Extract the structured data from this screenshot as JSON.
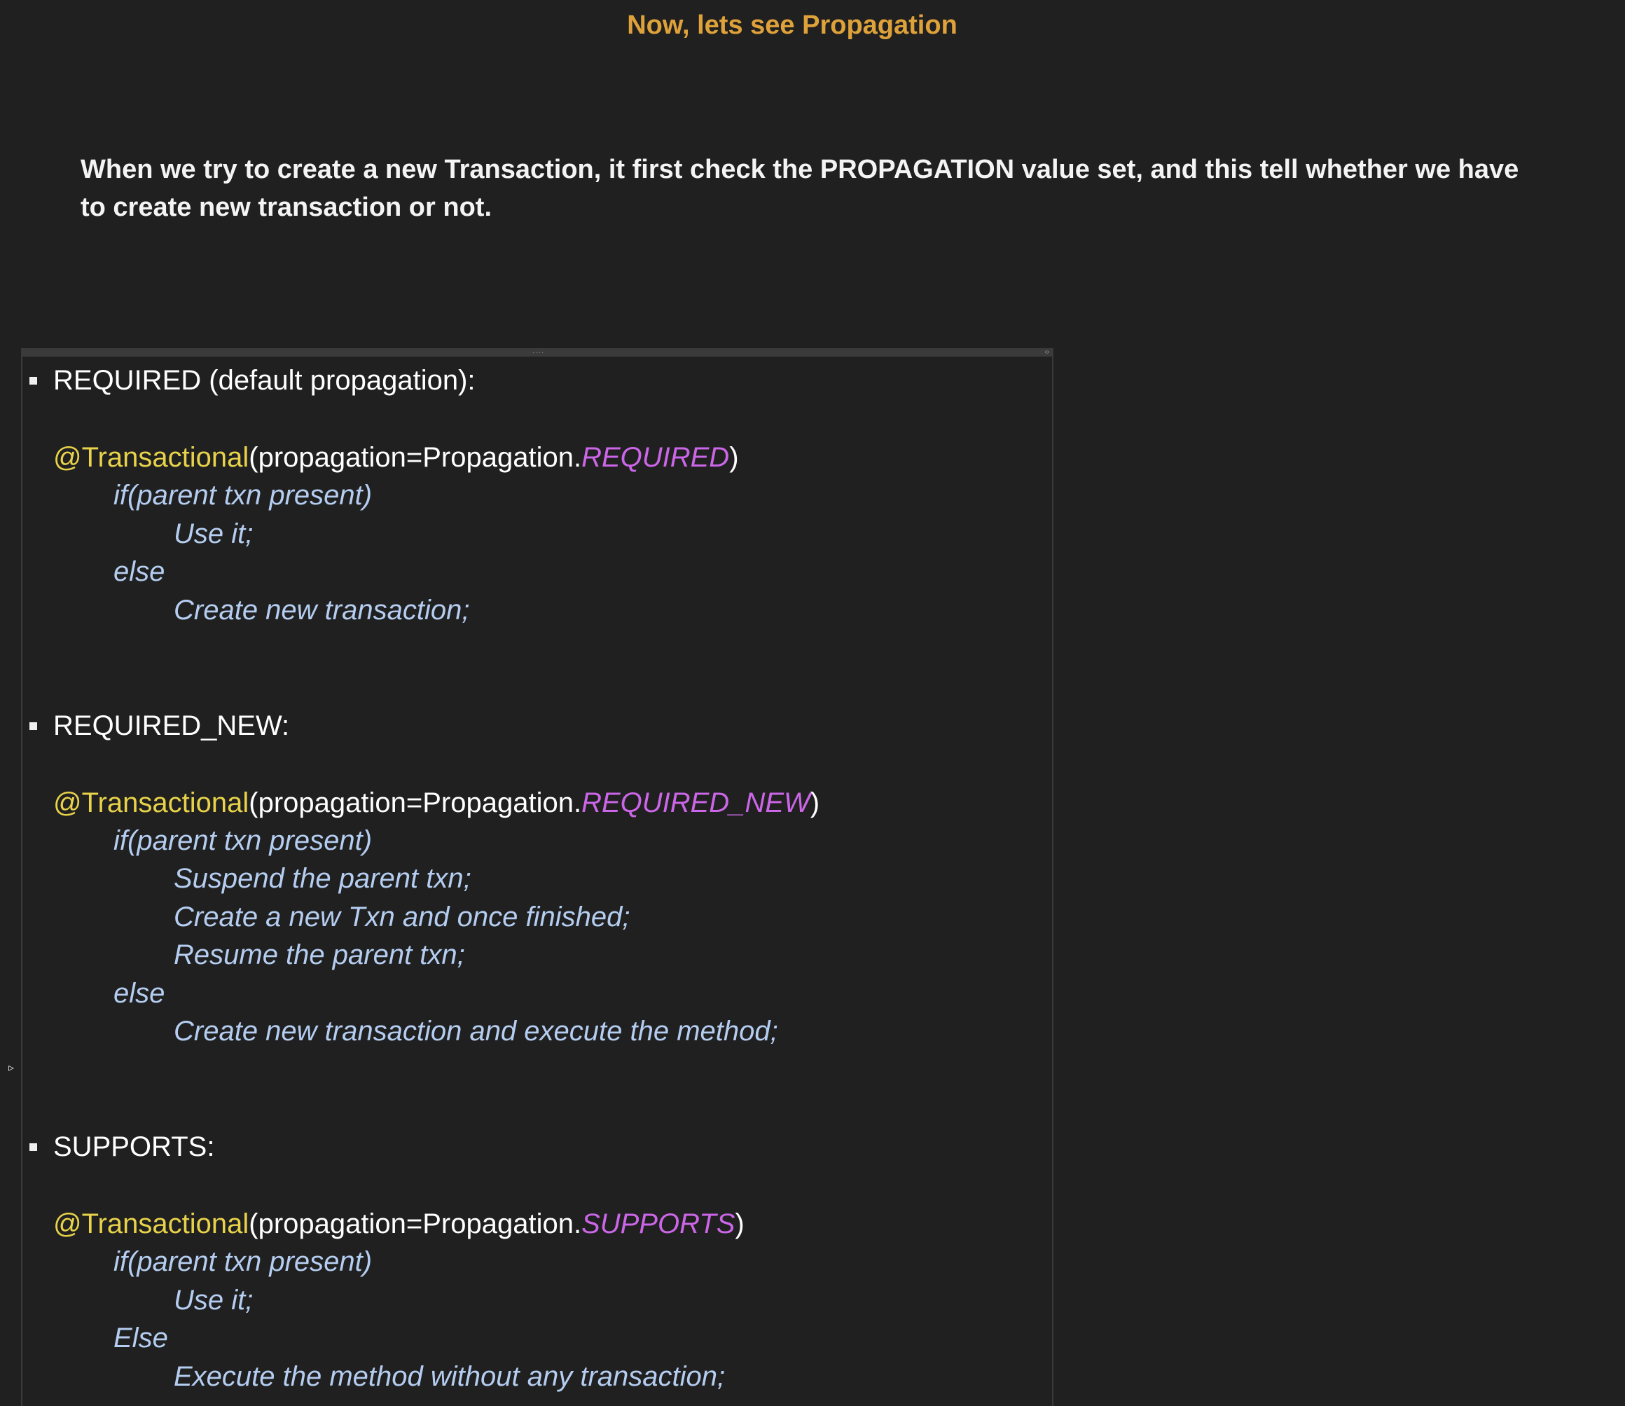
{
  "title": "Now, lets see Propagation",
  "intro": "When we try to create a new Transaction, it first check the PROPAGATION value set, and this tell whether we have to create new transaction or not.",
  "sections": [
    {
      "heading": "REQUIRED (default propagation):",
      "annotation": "@Transactional",
      "call_prefix": "(propagation=Propagation.",
      "enum_value": "REQUIRED",
      "call_suffix": ")",
      "lines": [
        "if(parent txn present)",
        "Use it;",
        "else",
        "Create new transaction;"
      ]
    },
    {
      "heading": "REQUIRED_NEW:",
      "annotation": "@Transactional",
      "call_prefix": "(propagation=Propagation.",
      "enum_value": "REQUIRED_NEW",
      "call_suffix": ")",
      "lines": [
        "if(parent txn present)",
        "Suspend the parent txn;",
        "Create a new Txn and once finished;",
        "Resume the parent txn;",
        "else",
        "Create new transaction and execute the method;"
      ]
    },
    {
      "heading": "SUPPORTS:",
      "annotation": "@Transactional",
      "call_prefix": "(propagation=Propagation.",
      "enum_value": "SUPPORTS",
      "call_suffix": ")",
      "lines": [
        "if(parent txn present)",
        "Use it;",
        "Else",
        "Execute the method without any transaction;"
      ]
    }
  ],
  "colors": {
    "background": "#202020",
    "title": "#dfa23a",
    "annotation": "#e8d24a",
    "enum": "#cc66e8",
    "code": "#b4cdf0"
  }
}
